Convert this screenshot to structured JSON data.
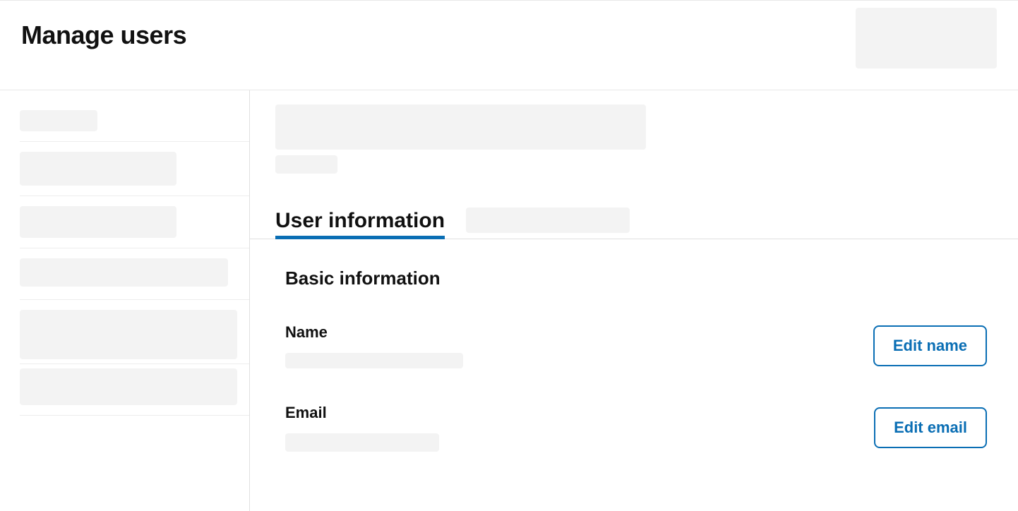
{
  "header": {
    "title": "Manage users"
  },
  "tabs": {
    "active_label": "User information"
  },
  "panel": {
    "section_heading": "Basic information",
    "fields": {
      "name": {
        "label": "Name",
        "action_label": "Edit name"
      },
      "email": {
        "label": "Email",
        "action_label": "Edit email"
      }
    }
  }
}
